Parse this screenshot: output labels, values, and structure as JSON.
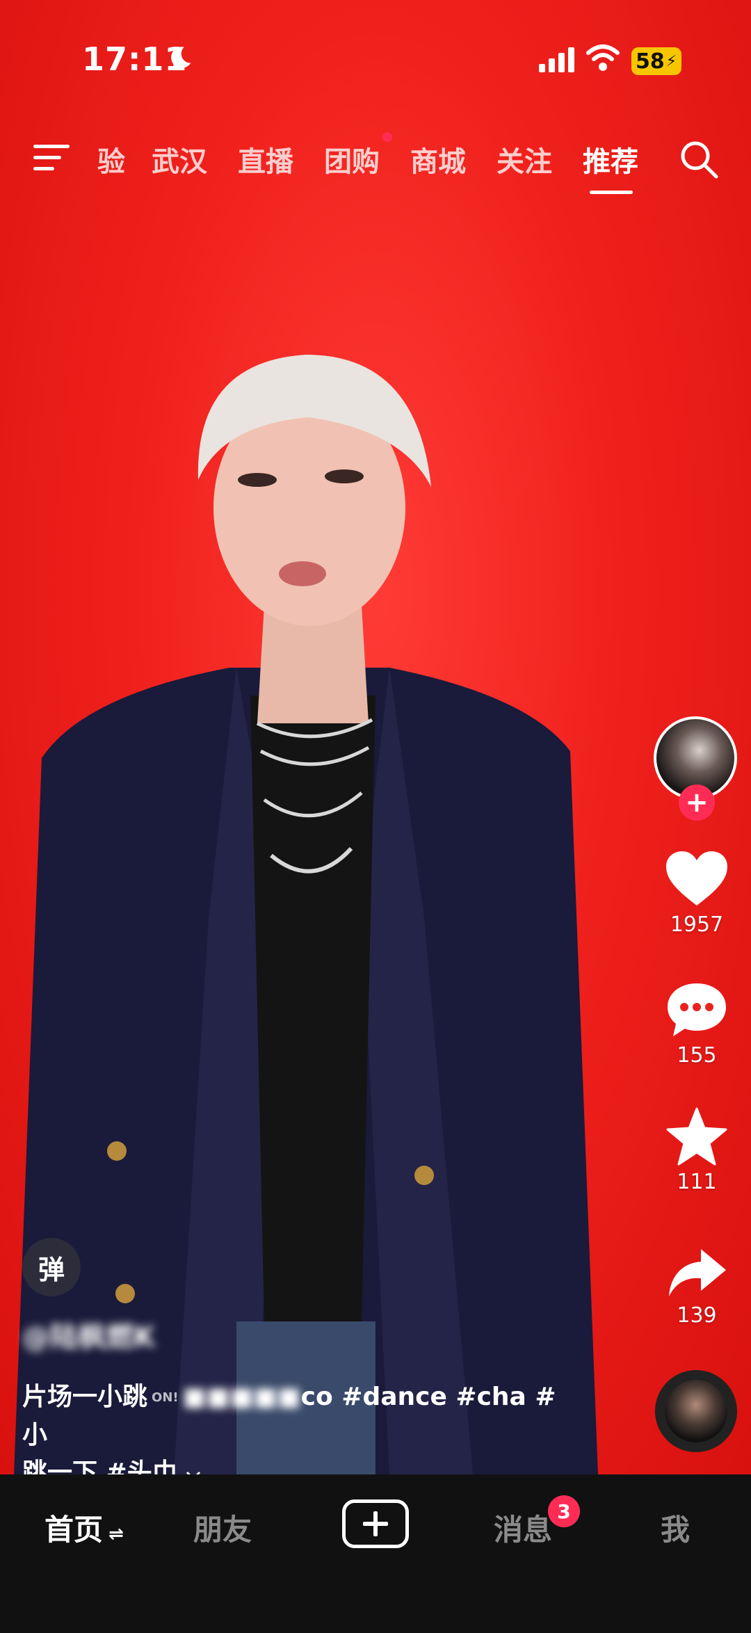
{
  "status_bar": {
    "time": "17:11",
    "battery": "58"
  },
  "top_nav": {
    "tabs": [
      "验",
      "武汉",
      "直播",
      "团购",
      "商城",
      "关注",
      "推荐"
    ],
    "active": "推荐"
  },
  "actions": {
    "likes": "1957",
    "comments": "155",
    "favorites": "111",
    "shares": "139"
  },
  "video_info": {
    "danmu_label": "弹",
    "author": "@陆枫燃K",
    "caption_line1_a": "片场一小跳",
    "caption_on_badge": "ON!",
    "caption_line1_b": "co #dance #cha #小",
    "caption_line2": "跳一下 #头巾"
  },
  "bottom_nav": {
    "home": "首页",
    "friends": "朋友",
    "messages": "消息",
    "messages_badge": "3",
    "me": "我"
  },
  "colors": {
    "accent": "#fe2c55",
    "video_bg": "#f0211d",
    "battery": "#f7c600"
  }
}
